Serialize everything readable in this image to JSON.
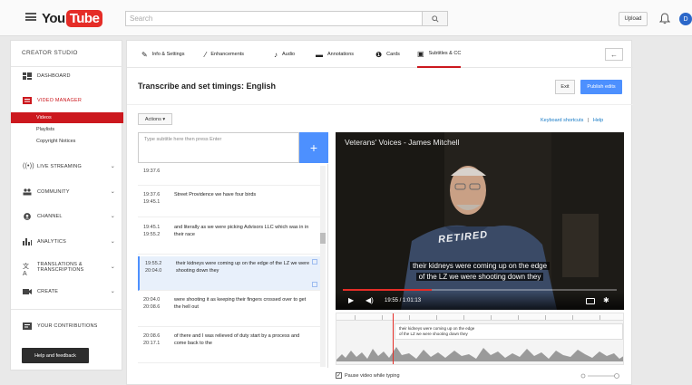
{
  "header": {
    "logo_you": "You",
    "logo_tube": "Tube",
    "search_placeholder": "Search",
    "upload_label": "Upload",
    "avatar_initial": "D"
  },
  "sidebar": {
    "title": "CREATOR STUDIO",
    "items": [
      {
        "label": "DASHBOARD",
        "icon": "dashboard-icon"
      },
      {
        "label": "VIDEO MANAGER",
        "icon": "video-manager-icon"
      },
      {
        "label": "LIVE STREAMING",
        "icon": "live-icon"
      },
      {
        "label": "COMMUNITY",
        "icon": "community-icon"
      },
      {
        "label": "CHANNEL",
        "icon": "channel-icon"
      },
      {
        "label": "ANALYTICS",
        "icon": "analytics-icon"
      },
      {
        "label": "TRANSLATIONS & TRANSCRIPTIONS",
        "icon": "translate-icon"
      },
      {
        "label": "CREATE",
        "icon": "create-icon"
      },
      {
        "label": "YOUR CONTRIBUTIONS",
        "icon": "contributions-icon"
      }
    ],
    "sub_items": [
      "Videos",
      "Playlists",
      "Copyright Notices"
    ],
    "help_label": "Help and feedback"
  },
  "tabs": [
    {
      "label": "Info & Settings",
      "icon": "pencil-icon"
    },
    {
      "label": "Enhancements",
      "icon": "wand-icon"
    },
    {
      "label": "Audio",
      "icon": "music-icon"
    },
    {
      "label": "Annotations",
      "icon": "annotation-icon"
    },
    {
      "label": "Cards",
      "icon": "info-icon"
    },
    {
      "label": "Subtitles & CC",
      "icon": "cc-icon"
    }
  ],
  "editor": {
    "title": "Transcribe and set timings: English",
    "exit_label": "Exit",
    "publish_label": "Publish edits",
    "actions_label": "Actions ▾",
    "keyboard_shortcuts": "Keyboard shortcuts",
    "separator": "|",
    "help_link": "Help",
    "input_placeholder": "Type subtitle here then press Enter",
    "add_label": "+",
    "pause_label": "Pause video while typing"
  },
  "subtitles": [
    {
      "start": "19:37.6",
      "end": "",
      "text": ""
    },
    {
      "start": "19:37.6",
      "end": "19:45.1",
      "text": "Street Providence we have four birds"
    },
    {
      "start": "19:45.1",
      "end": "19:55.2",
      "text": "and literally as we were picking Advisors LLC which was in in their race"
    },
    {
      "start": "19:55.2",
      "end": "20:04.0",
      "text": "their kidneys were coming up on the edge of the LZ we were shooting down they"
    },
    {
      "start": "20:04.0",
      "end": "20:08.6",
      "text": "were shooting it as keeping their fingers crossed over to get the hell out"
    },
    {
      "start": "20:08.6",
      "end": "20:17.1",
      "text": "of there and I was relieved of duty start by a process and come back to the"
    }
  ],
  "video": {
    "title": "Veterans' Voices - James Mitchell",
    "caption_line1": "their kidneys were coming up on the edge",
    "caption_line2": "of the LZ we were shooting down they",
    "time": "19:55 / 1:01:13",
    "progress": 0.325,
    "shirt_text": "RETIRED"
  },
  "timeline": {
    "block_text_line1": "their kidneys were coming up on the edge",
    "block_text_line2": "of the LZ we were shooting down they"
  },
  "colors": {
    "accent": "#cc181e",
    "blue": "#4d90fe"
  }
}
